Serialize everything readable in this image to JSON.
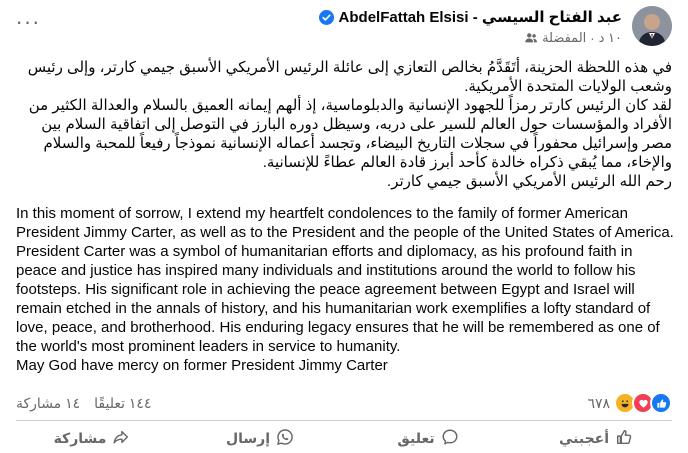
{
  "header": {
    "author_name": "AbdelFattah Elsisi - عبد الفتاح السيسي",
    "audience": "المفضلة",
    "time": "١٠ د",
    "more_label": "···"
  },
  "post": {
    "arabic_paragraphs": [
      "في هذه اللحظة الحزينة، أتَقَدَّمُ بخالص التعازي إلى عائلة الرئيس الأمريكي الأسبق جيمي كارتر، وإلى رئيس وشعب الولايات المتحدة الأمريكية.",
      "لقد كان الرئيس كارتر رمزاً للجهود الإنسانية والدبلوماسية، إذ ألهم إيمانه العميق بالسلام والعدالة الكثير من الأفراد والمؤسسات حول العالم للسير على دربه، وسيظل دوره البارز في التوصل إلى اتفاقية السلام بين مصر وإسرائيل محفوراً في سجلات التاريخ البيضاء، وتجسد أعماله الإنسانية نموذجاً رفيعاً للمحبة والسلام والإخاء، مما يُبقي ذكراه خالدة كأحد أبرز قادة العالم عطاءً للإنسانية.",
      "رحم الله الرئيس الأمريكي الأسبق جيمي كارتر."
    ],
    "english_paragraphs": [
      "In this moment of sorrow, I extend my heartfelt condolences to the family of former American President Jimmy Carter, as well as to the President and the people of the United States of America. President Carter was a symbol of humanitarian efforts and diplomacy, as his profound faith in peace and justice has inspired many individuals and institutions around the world to follow his footsteps. His significant role in achieving the peace agreement between Egypt and Israel will remain etched in the annals of history, and his humanitarian work exemplifies a lofty standard of love, peace, and brotherhood. His enduring legacy ensures that he will be remembered as one of the world's most prominent leaders in service to humanity.",
      "May God have mercy on former President Jimmy Carter"
    ]
  },
  "stats": {
    "reactions_count": "٦٧٨",
    "comments": "١٤٤ تعليقًا",
    "shares": "١٤ مشاركة"
  },
  "actions": {
    "like": "أعجبني",
    "comment": "تعليق",
    "send": "إرسال",
    "share": "مشاركة"
  },
  "colors": {
    "verified": "#1877f2",
    "like_blue": "#1877f2",
    "love_red": "#f33e58",
    "haha_yellow": "#f7b125"
  }
}
